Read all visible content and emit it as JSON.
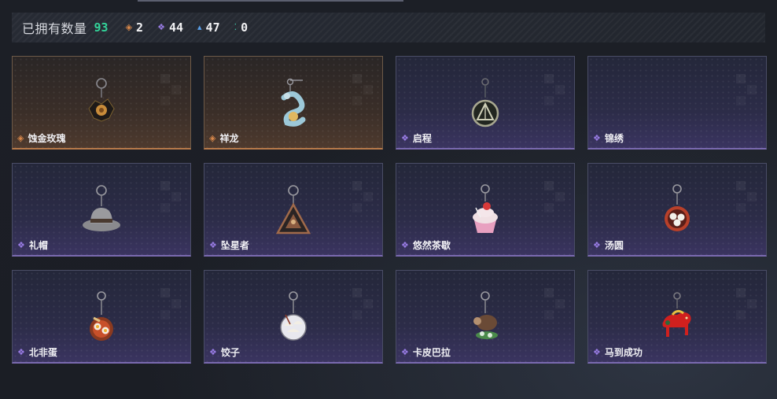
{
  "summary": {
    "label": "已拥有数量",
    "total": "93",
    "counts": [
      {
        "icon": "orange-diamond-icon",
        "color": "#d9884a",
        "value": "2"
      },
      {
        "icon": "purple-diamond-icon",
        "color": "#9a7de6",
        "value": "44"
      },
      {
        "icon": "blue-triangle-icon",
        "color": "#5a9fe8",
        "value": "47"
      },
      {
        "icon": "teal-dots-icon",
        "color": "#3cc9a8",
        "value": "0"
      }
    ]
  },
  "items": [
    {
      "name": "蚀金玫瑰",
      "rarity": "gold",
      "charm": "black-gold-rose-charm"
    },
    {
      "name": "祥龙",
      "rarity": "gold",
      "charm": "jade-dragon-charm"
    },
    {
      "name": "启程",
      "rarity": "purple",
      "charm": "triangle-ring-charm"
    },
    {
      "name": "锦绣",
      "rarity": "purple",
      "charm": "empty-charm"
    },
    {
      "name": "礼帽",
      "rarity": "purple",
      "charm": "gray-hat-charm"
    },
    {
      "name": "坠星者",
      "rarity": "purple",
      "charm": "star-triangle-charm"
    },
    {
      "name": "悠然茶歇",
      "rarity": "purple",
      "charm": "cupcake-charm"
    },
    {
      "name": "汤圆",
      "rarity": "purple",
      "charm": "rice-ball-bowl-charm"
    },
    {
      "name": "北非蛋",
      "rarity": "purple",
      "charm": "shakshuka-charm"
    },
    {
      "name": "饺子",
      "rarity": "purple",
      "charm": "dumpling-plate-charm"
    },
    {
      "name": "卡皮巴拉",
      "rarity": "purple",
      "charm": "capybara-charm"
    },
    {
      "name": "马到成功",
      "rarity": "purple",
      "charm": "red-horse-charm"
    }
  ]
}
